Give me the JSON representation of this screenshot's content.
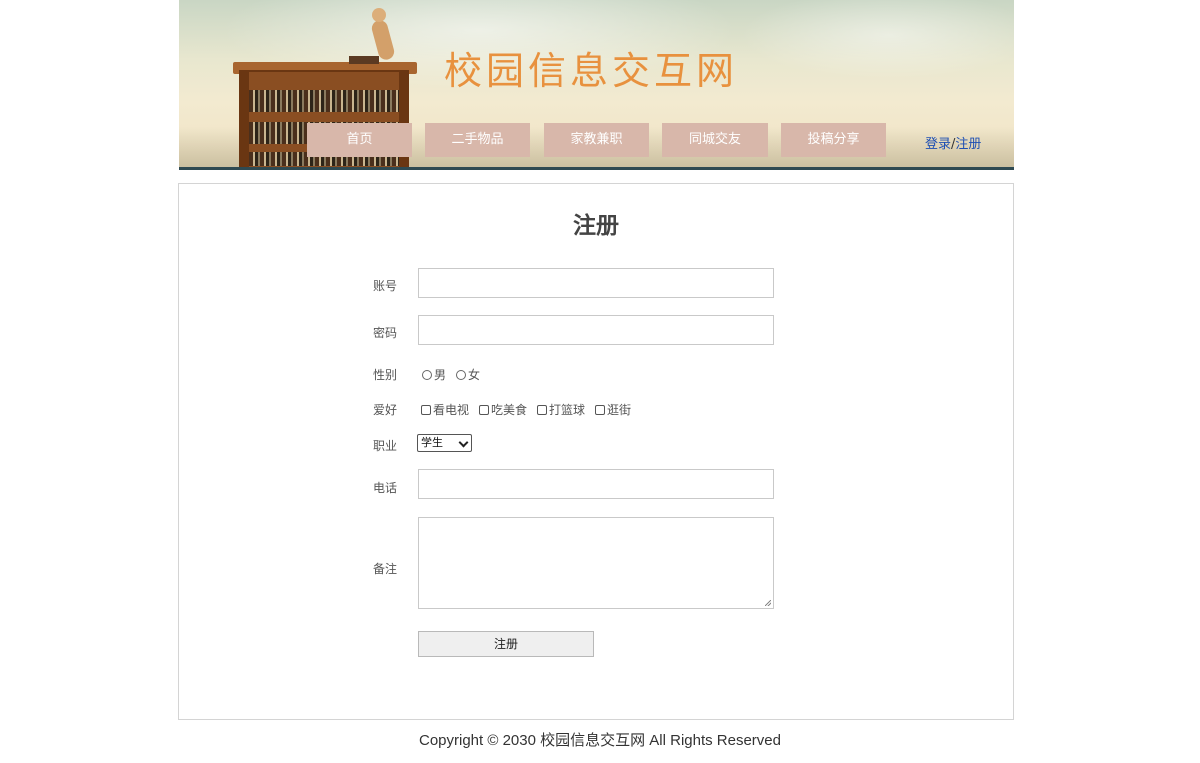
{
  "header": {
    "site_title": "校园信息交互网",
    "nav": [
      "首页",
      "二手物品",
      "家教兼职",
      "同城交友",
      "投稿分享"
    ],
    "login_label": "登录",
    "auth_separator": "/",
    "register_link_label": "注册"
  },
  "form": {
    "title": "注册",
    "account_label": "账号",
    "account_value": "",
    "password_label": "密码",
    "password_value": "",
    "gender_label": "性别",
    "gender_options": [
      "男",
      "女"
    ],
    "hobby_label": "爱好",
    "hobby_options": [
      "看电视",
      "吃美食",
      "打篮球",
      "逛街"
    ],
    "job_label": "职业",
    "job_selected": "学生",
    "phone_label": "电话",
    "phone_value": "",
    "remark_label": "备注",
    "remark_value": "",
    "submit_label": "注册"
  },
  "footer": {
    "copyright": "Copyright © 2030 校园信息交互网 All Rights Reserved"
  },
  "colors": {
    "nav_button_bg": "#d8b7aa",
    "title_orange": "#e8913e",
    "link_blue": "#1e4fb3"
  }
}
